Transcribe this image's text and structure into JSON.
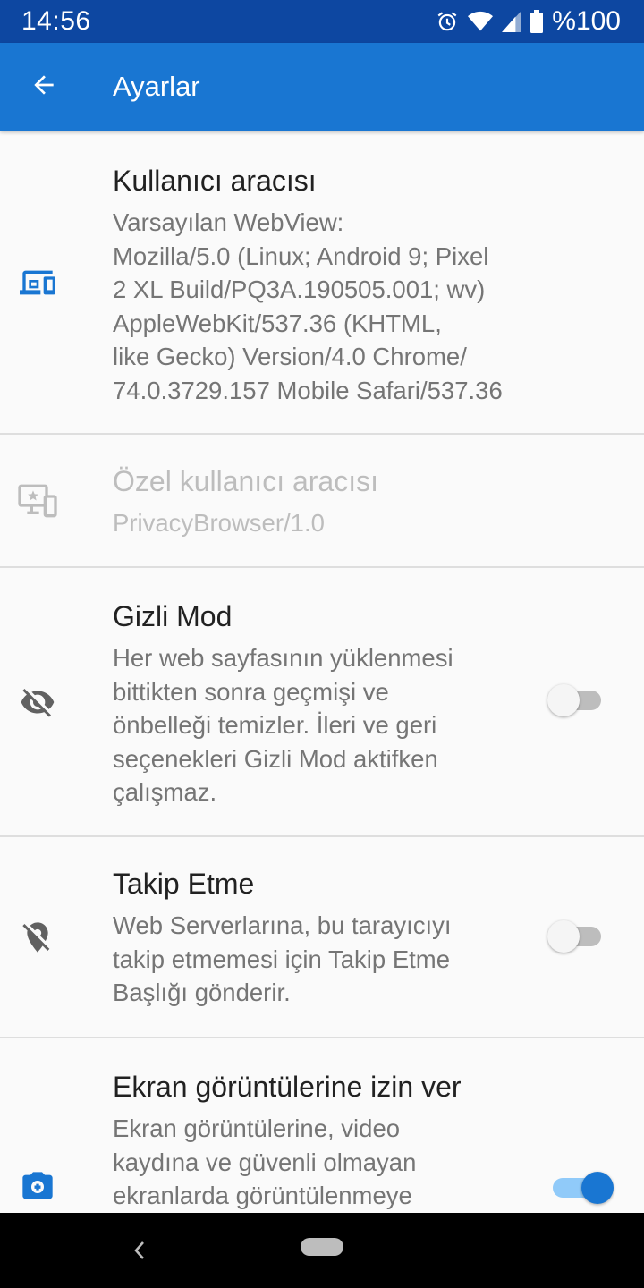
{
  "status_bar": {
    "time": "14:56",
    "battery_text": "%100"
  },
  "app_bar": {
    "title": "Ayarlar"
  },
  "preferences": [
    {
      "title": "Kullanıcı aracısı",
      "summary_lines": [
        "Varsayılan WebView:",
        "Mozilla/5.0 (Linux; Android 9; Pixel",
        "2 XL Build/PQ3A.190505.001; wv)",
        "AppleWebKit/537.36 (KHTML,",
        "like Gecko) Version/4.0 Chrome/",
        "74.0.3729.157 Mobile Safari/537.36"
      ],
      "icon": "devices-icon"
    },
    {
      "title": "Özel kullanıcı aracısı",
      "summary_lines": [
        "PrivacyBrowser/1.0"
      ],
      "icon": "custom-device-icon",
      "enabled": false
    },
    {
      "title": "Gizli Mod",
      "summary_lines": [
        "Her web sayfasının yüklenmesi",
        "bittikten sonra geçmişi ve",
        "önbelleği temizler. İleri ve geri",
        "seçenekleri Gizli Mod aktifken",
        "çalışmaz."
      ],
      "icon": "visibility-off-icon",
      "switch_on": false
    },
    {
      "title": "Takip Etme",
      "summary_lines": [
        "Web Serverlarına, bu tarayıcıyı",
        "takip etmemesi için Takip Etme",
        "Başlığı gönderir."
      ],
      "icon": "location-off-icon",
      "switch_on": false
    },
    {
      "title": "Ekran görüntülerine izin ver",
      "summary_lines": [
        "Ekran görüntülerine, video",
        "kaydına ve güvenli olmayan",
        "ekranlarda görüntülenmeye"
      ],
      "icon": "camera-icon",
      "switch_on": true
    }
  ],
  "colors": {
    "status_bar": "#0d47a1",
    "app_bar": "#1976d2",
    "accent": "#1976d2",
    "icon_inactive": "#616161"
  }
}
